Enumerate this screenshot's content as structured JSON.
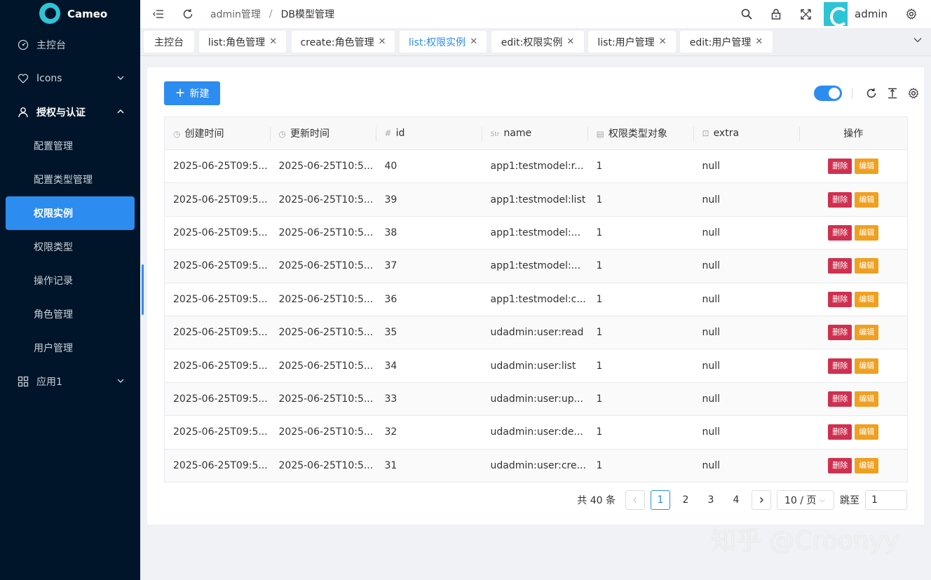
{
  "app": {
    "logo_text": "Cameo"
  },
  "sidebar": {
    "items": [
      {
        "label": "主控台",
        "icon": "dashboard-icon"
      },
      {
        "label": "Icons",
        "icon": "heart-icon",
        "arrow": "down"
      },
      {
        "label": "授权与认证",
        "icon": "user-icon",
        "arrow": "up"
      }
    ],
    "sub_items": [
      "配置管理",
      "配置类型管理",
      "权限实例",
      "权限类型",
      "操作记录",
      "角色管理",
      "用户管理"
    ],
    "active_sub": "权限实例",
    "app_item": {
      "label": "应用1",
      "icon": "grid-icon",
      "arrow": "down"
    }
  },
  "header": {
    "breadcrumb": [
      "admin管理",
      "DB模型管理"
    ],
    "user": "admin"
  },
  "tabs": [
    {
      "label": "主控台",
      "closable": false
    },
    {
      "label": "list:角色管理",
      "closable": true
    },
    {
      "label": "create:角色管理",
      "closable": true
    },
    {
      "label": "list:权限实例",
      "closable": true,
      "active": true
    },
    {
      "label": "edit:权限实例",
      "closable": true
    },
    {
      "label": "list:用户管理",
      "closable": true
    },
    {
      "label": "edit:用户管理",
      "closable": true
    }
  ],
  "toolbar": {
    "new_label": "新建"
  },
  "table": {
    "columns": [
      "创建时间",
      "更新时间",
      "id",
      "name",
      "权限类型对象",
      "extra",
      "操作"
    ],
    "delete_label": "删除",
    "edit_label": "编辑",
    "rows": [
      [
        "2025-06-25T09:5...",
        "2025-06-25T10:5...",
        "40",
        "app1:testmodel:r...",
        "1",
        "null"
      ],
      [
        "2025-06-25T09:5...",
        "2025-06-25T10:5...",
        "39",
        "app1:testmodel:list",
        "1",
        "null"
      ],
      [
        "2025-06-25T09:5...",
        "2025-06-25T10:5...",
        "38",
        "app1:testmodel:...",
        "1",
        "null"
      ],
      [
        "2025-06-25T09:5...",
        "2025-06-25T10:5...",
        "37",
        "app1:testmodel:...",
        "1",
        "null"
      ],
      [
        "2025-06-25T09:5...",
        "2025-06-25T10:5...",
        "36",
        "app1:testmodel:c...",
        "1",
        "null"
      ],
      [
        "2025-06-25T09:5...",
        "2025-06-25T10:5...",
        "35",
        "udadmin:user:read",
        "1",
        "null"
      ],
      [
        "2025-06-25T09:5...",
        "2025-06-25T10:5...",
        "34",
        "udadmin:user:list",
        "1",
        "null"
      ],
      [
        "2025-06-25T09:5...",
        "2025-06-25T10:5...",
        "33",
        "udadmin:user:up...",
        "1",
        "null"
      ],
      [
        "2025-06-25T09:5...",
        "2025-06-25T10:5...",
        "32",
        "udadmin:user:de...",
        "1",
        "null"
      ],
      [
        "2025-06-25T09:5...",
        "2025-06-25T10:5...",
        "31",
        "udadmin:user:cre...",
        "1",
        "null"
      ]
    ]
  },
  "pagination": {
    "total": "共 40 条",
    "pages": [
      "1",
      "2",
      "3",
      "4"
    ],
    "current": "1",
    "page_size": "10 / 页",
    "jump_label": "跳至",
    "jump_value": "1"
  },
  "watermark": "知乎 @Croonyy",
  "colors": {
    "sidebar_bg": "#001529",
    "primary": "#2d8cf0",
    "danger": "#d03050",
    "warning": "#f0a020"
  }
}
